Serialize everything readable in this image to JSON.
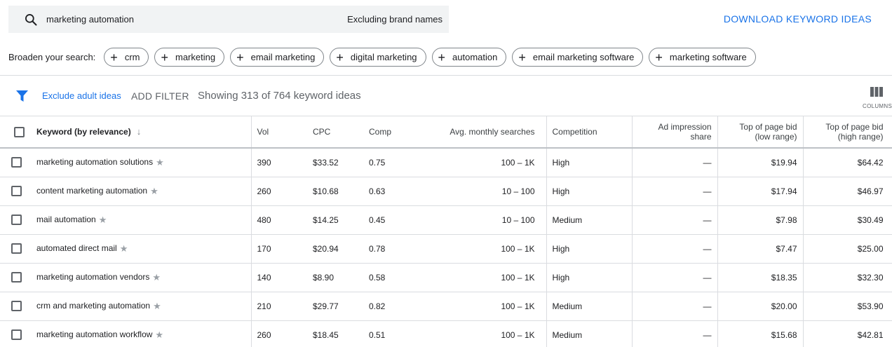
{
  "search": {
    "query": "marketing automation",
    "brand_filter": "Excluding brand names"
  },
  "download_label": "DOWNLOAD KEYWORD IDEAS",
  "broaden": {
    "label": "Broaden your search:",
    "chips": [
      "crm",
      "marketing",
      "email marketing",
      "digital marketing",
      "automation",
      "email marketing software",
      "marketing software"
    ]
  },
  "filter_bar": {
    "exclude_label": "Exclude adult ideas",
    "add_filter_label": "ADD FILTER",
    "showing_text": "Showing 313 of 764 keyword ideas",
    "columns_label": "COLUMNS"
  },
  "table": {
    "headers": {
      "keyword": "Keyword (by relevance)",
      "vol": "Vol",
      "cpc": "CPC",
      "comp": "Comp",
      "avg": "Avg. monthly searches",
      "competition": "Competition",
      "ais_line1": "Ad impression",
      "ais_line2": "share",
      "low_line1": "Top of page bid",
      "low_line2": "(low range)",
      "high_line1": "Top of page bid",
      "high_line2": "(high range)"
    },
    "rows": [
      {
        "keyword": "marketing automation solutions",
        "vol": "390",
        "cpc": "$33.52",
        "comp": "0.75",
        "avg": "100 – 1K",
        "competition": "High",
        "ais": "—",
        "low": "$19.94",
        "high": "$64.42"
      },
      {
        "keyword": "content marketing automation",
        "vol": "260",
        "cpc": "$10.68",
        "comp": "0.63",
        "avg": "10 – 100",
        "competition": "High",
        "ais": "—",
        "low": "$17.94",
        "high": "$46.97"
      },
      {
        "keyword": "mail automation",
        "vol": "480",
        "cpc": "$14.25",
        "comp": "0.45",
        "avg": "10 – 100",
        "competition": "Medium",
        "ais": "—",
        "low": "$7.98",
        "high": "$30.49"
      },
      {
        "keyword": "automated direct mail",
        "vol": "170",
        "cpc": "$20.94",
        "comp": "0.78",
        "avg": "100 – 1K",
        "competition": "High",
        "ais": "—",
        "low": "$7.47",
        "high": "$25.00"
      },
      {
        "keyword": "marketing automation vendors",
        "vol": "140",
        "cpc": "$8.90",
        "comp": "0.58",
        "avg": "100 – 1K",
        "competition": "High",
        "ais": "—",
        "low": "$18.35",
        "high": "$32.30"
      },
      {
        "keyword": "crm and marketing automation",
        "vol": "210",
        "cpc": "$29.77",
        "comp": "0.82",
        "avg": "100 – 1K",
        "competition": "Medium",
        "ais": "—",
        "low": "$20.00",
        "high": "$53.90"
      },
      {
        "keyword": "marketing automation workflow",
        "vol": "260",
        "cpc": "$18.45",
        "comp": "0.51",
        "avg": "100 – 1K",
        "competition": "Medium",
        "ais": "—",
        "low": "$15.68",
        "high": "$42.81"
      }
    ]
  },
  "colors": {
    "accent": "#1a73e8",
    "search_bg": "#f1f3f4",
    "divider": "#dadce0"
  }
}
